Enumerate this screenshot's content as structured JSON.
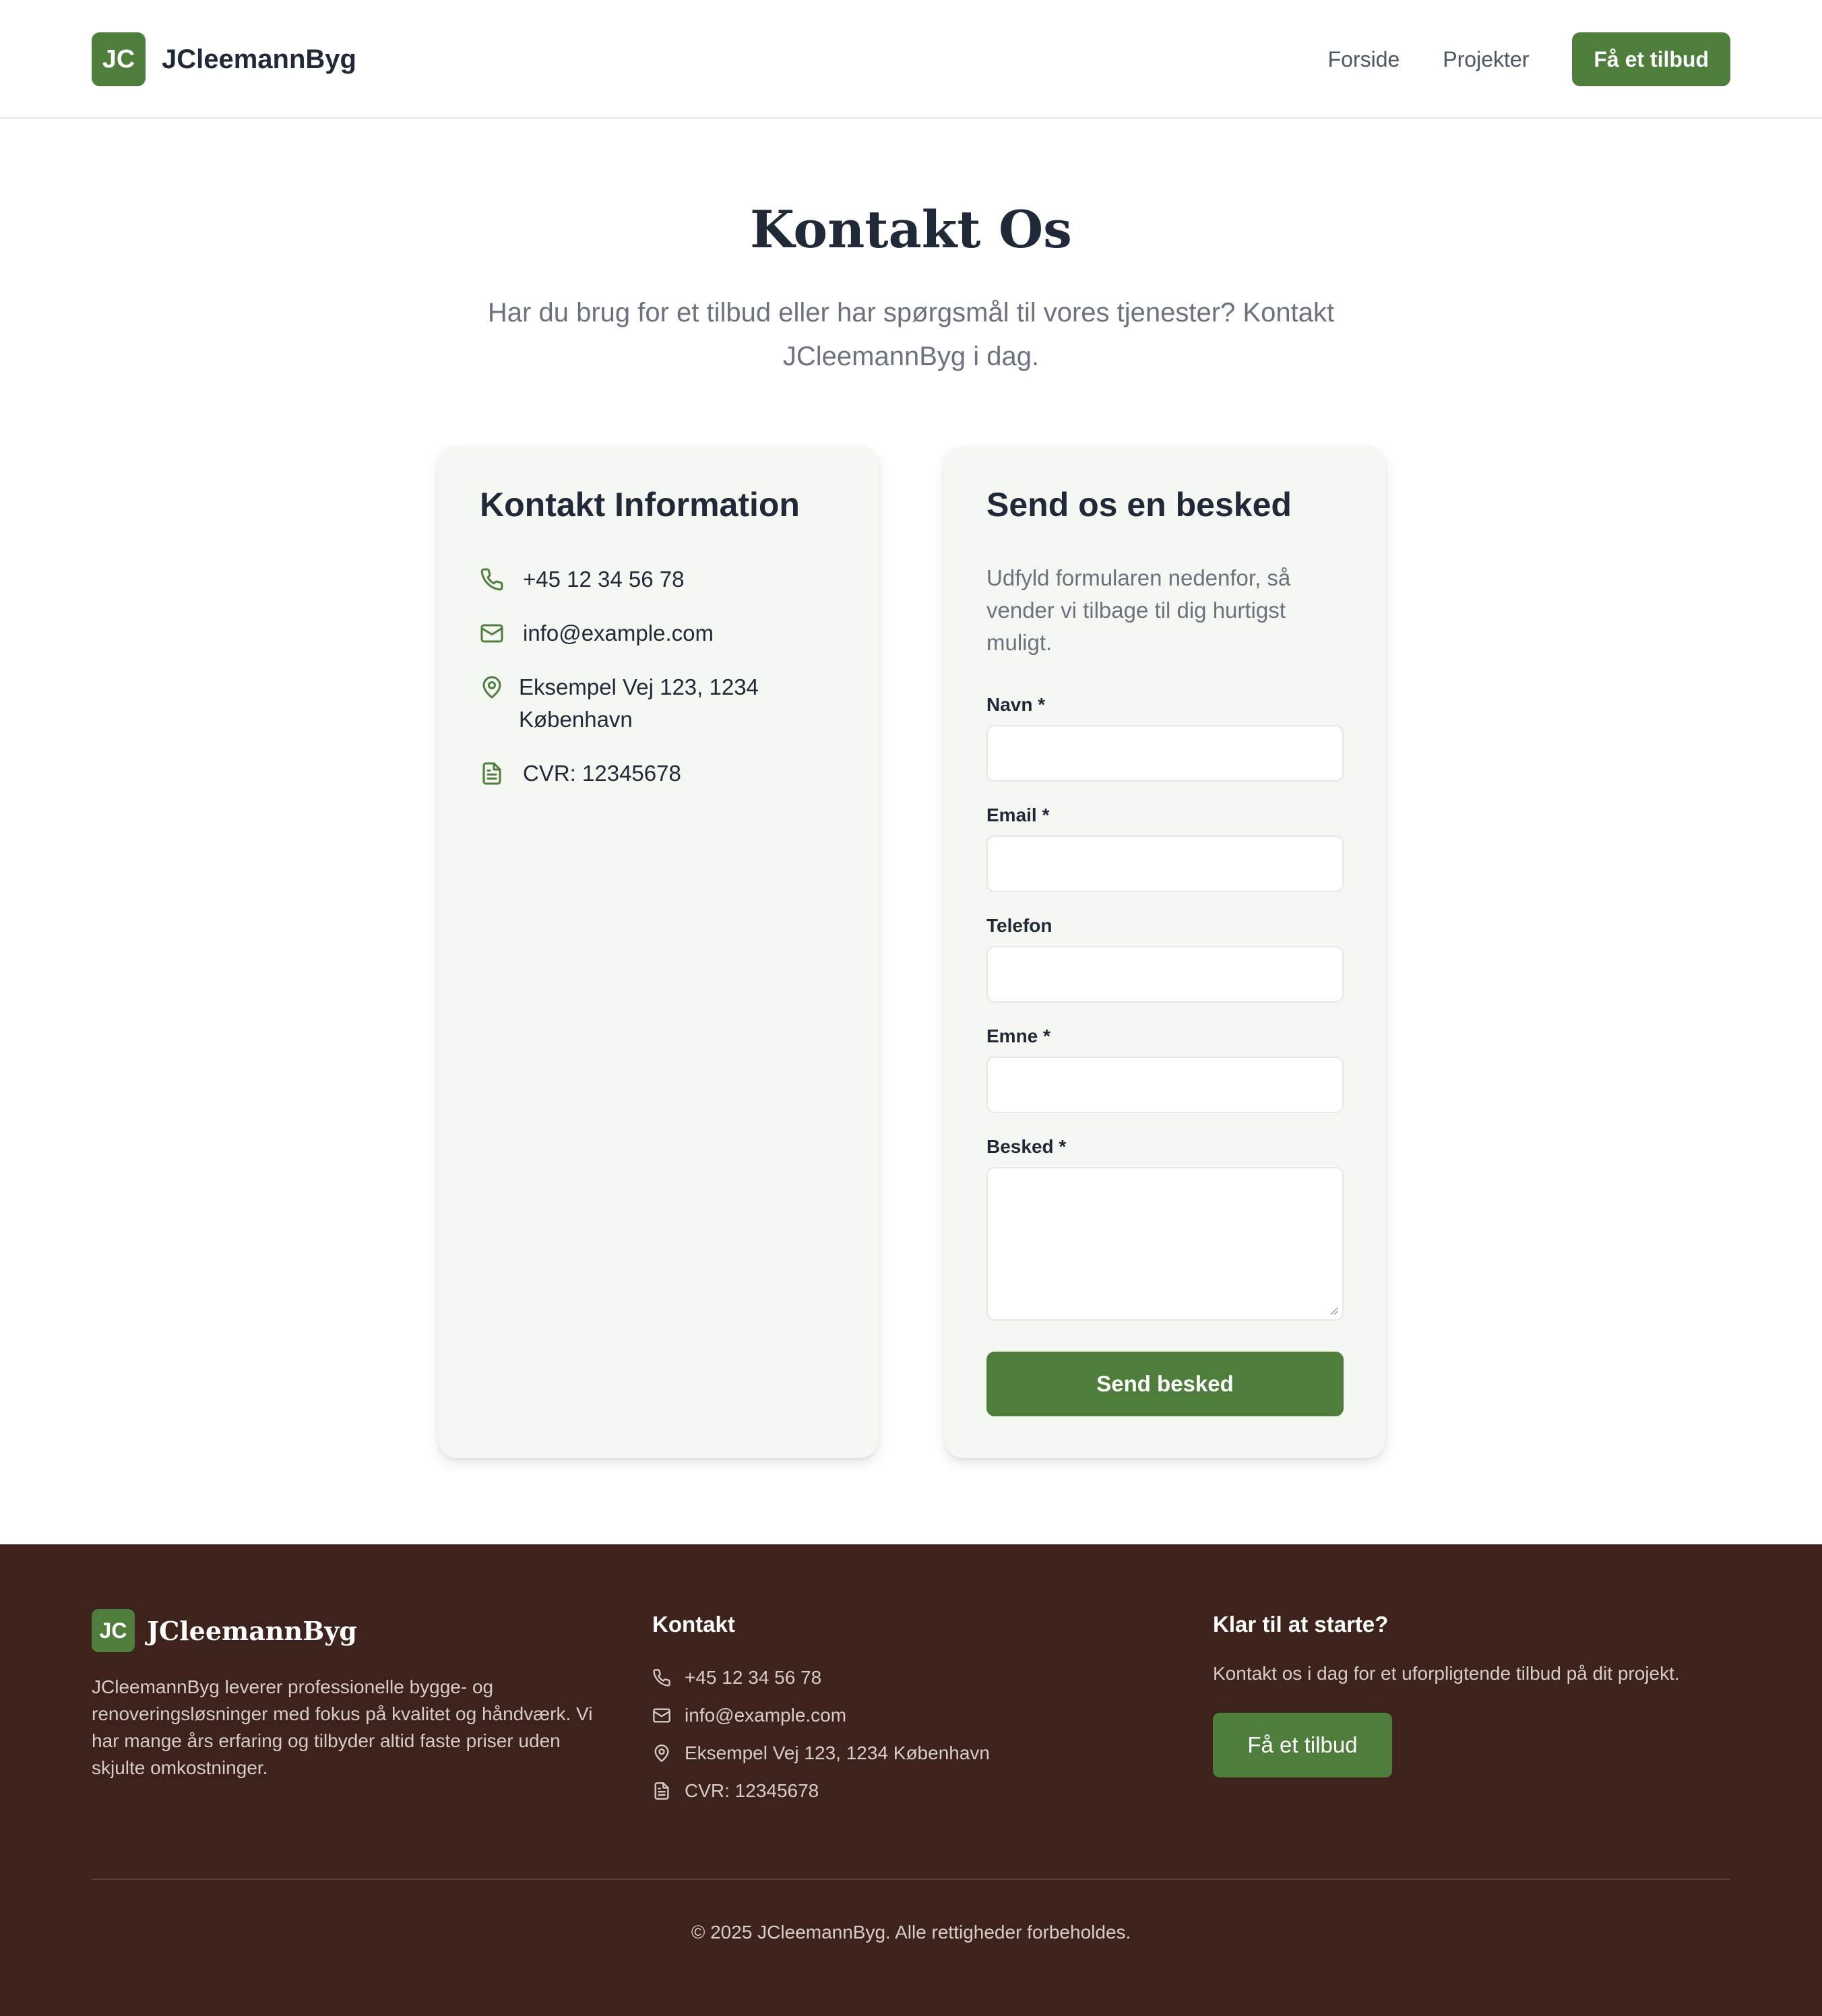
{
  "brand": {
    "initials": "JC",
    "name": "JCleemannByg"
  },
  "nav": {
    "links": [
      "Forside",
      "Projekter"
    ],
    "cta": "Få et tilbud"
  },
  "hero": {
    "title": "Kontakt Os",
    "subtitle": "Har du brug for et tilbud eller har spørgsmål til vores tjenester? Kontakt JCleemannByg i dag."
  },
  "contact_card": {
    "title": "Kontakt Information",
    "phone": "+45 12 34 56 78",
    "email": "info@example.com",
    "address_line1": "Eksempel Vej 123, 1234",
    "address_line2": "København",
    "cvr": "CVR: 12345678"
  },
  "form": {
    "title": "Send os en besked",
    "intro": "Udfyld formularen nedenfor, så vender vi tilbage til dig hurtigst muligt.",
    "fields": {
      "name_label": "Navn *",
      "email_label": "Email *",
      "phone_label": "Telefon",
      "subject_label": "Emne *",
      "message_label": "Besked *"
    },
    "submit": "Send besked"
  },
  "footer": {
    "about": "JCleemannByg leverer professionelle bygge- og renoveringsløsninger med fokus på kvalitet og håndværk. Vi har mange års erfaring og tilbyder altid faste priser uden skjulte omkostninger.",
    "contact_heading": "Kontakt",
    "phone": "+45 12 34 56 78",
    "email": "info@example.com",
    "address": "Eksempel Vej 123, 1234 København",
    "cvr": "CVR: 12345678",
    "cta_heading": "Klar til at starte?",
    "cta_text": "Kontakt os i dag for et uforpligtende tilbud på dit projekt.",
    "cta_button": "Få et tilbud",
    "copyright": "© 2025 JCleemannByg. Alle rettigheder forbeholdes."
  },
  "colors": {
    "brand_green": "#4e7d3c",
    "footer_brown": "#3d231b",
    "card_bg": "#f5f7f3"
  },
  "icons": {
    "phone": "phone-icon",
    "email": "mail-icon",
    "address": "map-pin-icon",
    "cvr": "document-icon"
  }
}
